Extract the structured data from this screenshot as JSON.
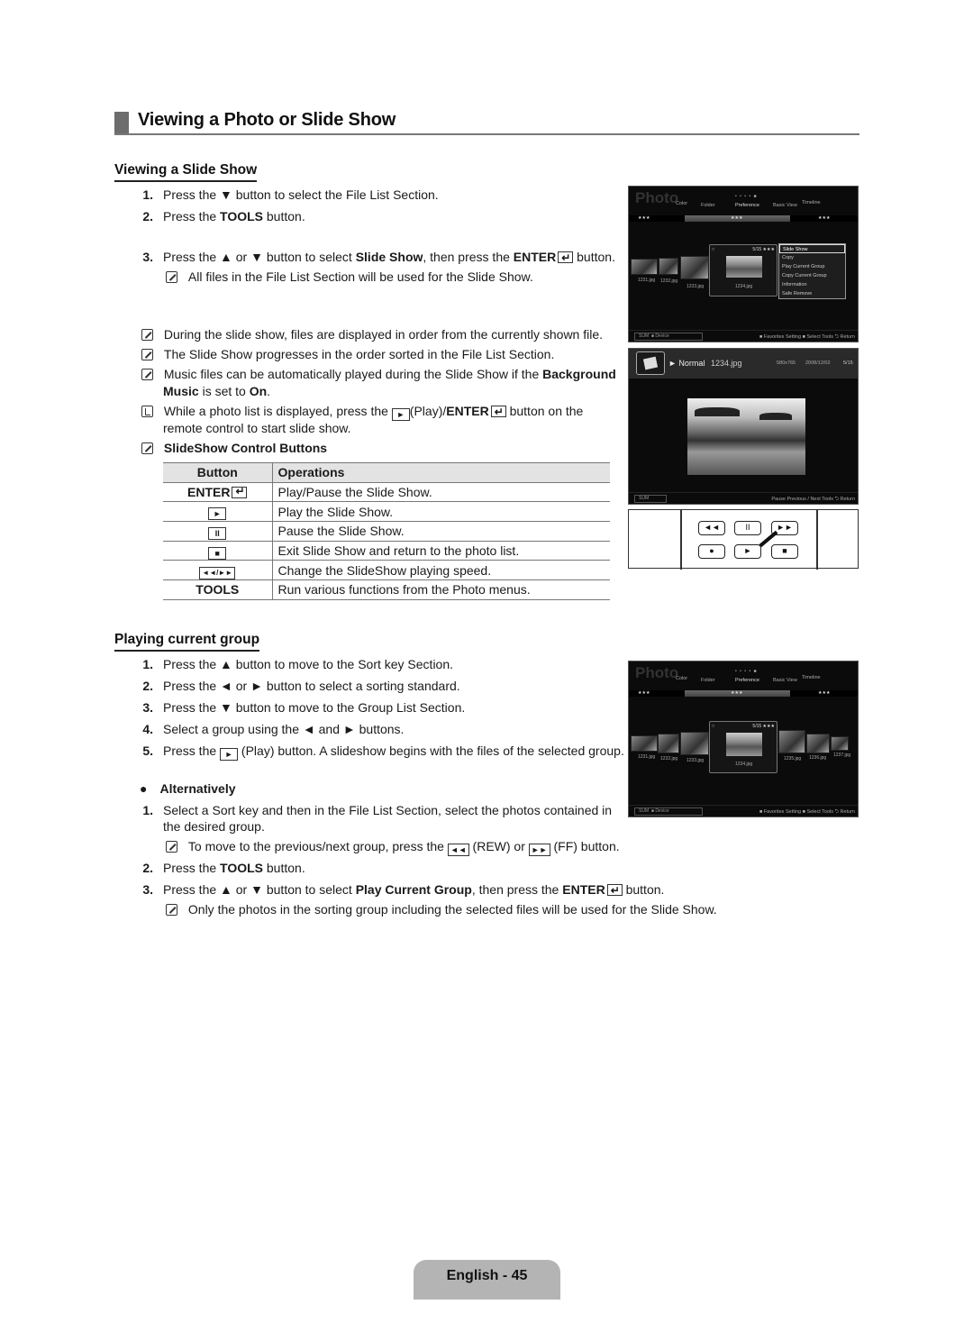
{
  "page": {
    "section_title": "Viewing a Photo or Slide Show",
    "footer": "English - 45"
  },
  "viewing": {
    "heading": "Viewing a Slide Show",
    "steps": [
      {
        "n": "1.",
        "pre": "Press the ▼ button to select the File List Section."
      },
      {
        "n": "2.",
        "pre": "Press the ",
        "bold": "TOOLS",
        "post": " button."
      },
      {
        "n": "3.",
        "pre": "Press the ▲ or ▼ button to select ",
        "bold": "Slide Show",
        "mid": ", then press the ",
        "bold2": "ENTER",
        "post": " button."
      }
    ],
    "step3_note": "All files in the File List Section will be used for the Slide Show.",
    "notes": [
      "During the slide show, files are displayed in order from the currently shown file.",
      "The Slide Show progresses in the order sorted in the File List Section."
    ],
    "music_note": {
      "pre": "Music files can be automatically played during the Slide Show if the ",
      "bold": "Background",
      "bold2": "Music",
      "mid": " is set to ",
      "bold3": "On",
      "post": "."
    },
    "tip": {
      "pre": "While a photo list is displayed, press the ",
      "key": "►",
      "mid": "(Play)/",
      "bold": "ENTER",
      "post": " button on the",
      "line2": "remote control to start slide show."
    },
    "controls_heading": "SlideShow Control Buttons",
    "table": {
      "headers": [
        "Button",
        "Operations"
      ],
      "rows": [
        {
          "button": "ENTER",
          "op": "Play/Pause the Slide Show."
        },
        {
          "button": "►",
          "op": "Play the Slide Show."
        },
        {
          "button": "II",
          "op": "Pause the Slide Show."
        },
        {
          "button": "■",
          "op": "Exit Slide Show and return to the photo list."
        },
        {
          "button": "◄◄/►►",
          "op": "Change the SlideShow playing speed."
        },
        {
          "button": "TOOLS",
          "op": "Run various functions from the Photo menus."
        }
      ]
    }
  },
  "group": {
    "heading": "Playing current group",
    "steps": [
      {
        "n": "1.",
        "text": "Press the ▲ button to move to the Sort key Section."
      },
      {
        "n": "2.",
        "text": "Press the ◄ or ► button to select a sorting standard."
      },
      {
        "n": "3.",
        "text": "Press the ▼ button to move to the Group List Section."
      },
      {
        "n": "4.",
        "text": "Select a group using the ◄ and ► buttons."
      },
      {
        "n": "5.",
        "pre": "Press the ",
        "key": "►",
        "post": " (Play) button. A slideshow begins with the files of the selected group."
      }
    ],
    "alt_heading": "Alternatively",
    "alt_steps": [
      {
        "n": "1.",
        "line1": "Select a Sort key and then in the File List Section, select the photos contained in",
        "line2": "the desired group."
      },
      {
        "n": "2.",
        "pre": "Press the ",
        "bold": "TOOLS",
        "post": " button."
      },
      {
        "n": "3.",
        "pre": "Press the ▲ or ▼ button to select ",
        "bold": "Play Current Group",
        "mid": ", then press the ",
        "bold2": "ENTER",
        "post": " button."
      }
    ],
    "alt_note1": {
      "pre": "To move to the previous/next group, press the ",
      "k1": "◄◄",
      "mid": " (REW) or ",
      "k2": "►►",
      "post": " (FF) button."
    },
    "alt_note2": "Only the photos in the sorting group including the selected files will be used for the Slide Show."
  },
  "screen1": {
    "title": "Photo",
    "tabs": [
      "Color",
      "Folder",
      "Preference",
      "Basic View",
      "Timeline"
    ],
    "sort_stars": [
      "★★★",
      "★★★",
      "★★★"
    ],
    "files": [
      "1231.jpg",
      "1232.jpg",
      "1233.jpg",
      "1234.jpg"
    ],
    "focus_info": "5/15 ★★★",
    "menu": [
      "Slide Show",
      "Copy",
      "Play Current Group",
      "Copy Current Group",
      "Information",
      "Safe Remove"
    ],
    "foot_left": [
      "SUM",
      "Device"
    ],
    "foot_right": "■ Favorites Setting  ■ Select  Tools  ⮌ Return"
  },
  "screen2": {
    "mode": "► Normal",
    "file": "1234.jpg",
    "resolution": "580x765",
    "date": "2008/12/02",
    "index": "5/15",
    "foot_left": "SUM",
    "foot_right": "Pause   Previous / Next   Tools   ⮌ Return"
  },
  "remote": {
    "buttons": [
      "◄◄",
      "II",
      "►►",
      "●",
      "►",
      "■"
    ]
  },
  "screen3": {
    "title": "Photo",
    "tabs": [
      "Color",
      "Folder",
      "Preference",
      "Basic View",
      "Timeline"
    ],
    "sort_stars": [
      "★★★",
      "★★★",
      "★★★"
    ],
    "files": [
      "1231.jpg",
      "1232.jpg",
      "1233.jpg",
      "1234.jpg",
      "1235.jpg",
      "1236.jpg",
      "1237.jpg"
    ],
    "focus_info": "5/15 ★★★",
    "foot_left": [
      "SUM",
      "Device"
    ],
    "foot_right": "■ Favorites Setting  ■ Select  Tools  ⮌ Return"
  }
}
